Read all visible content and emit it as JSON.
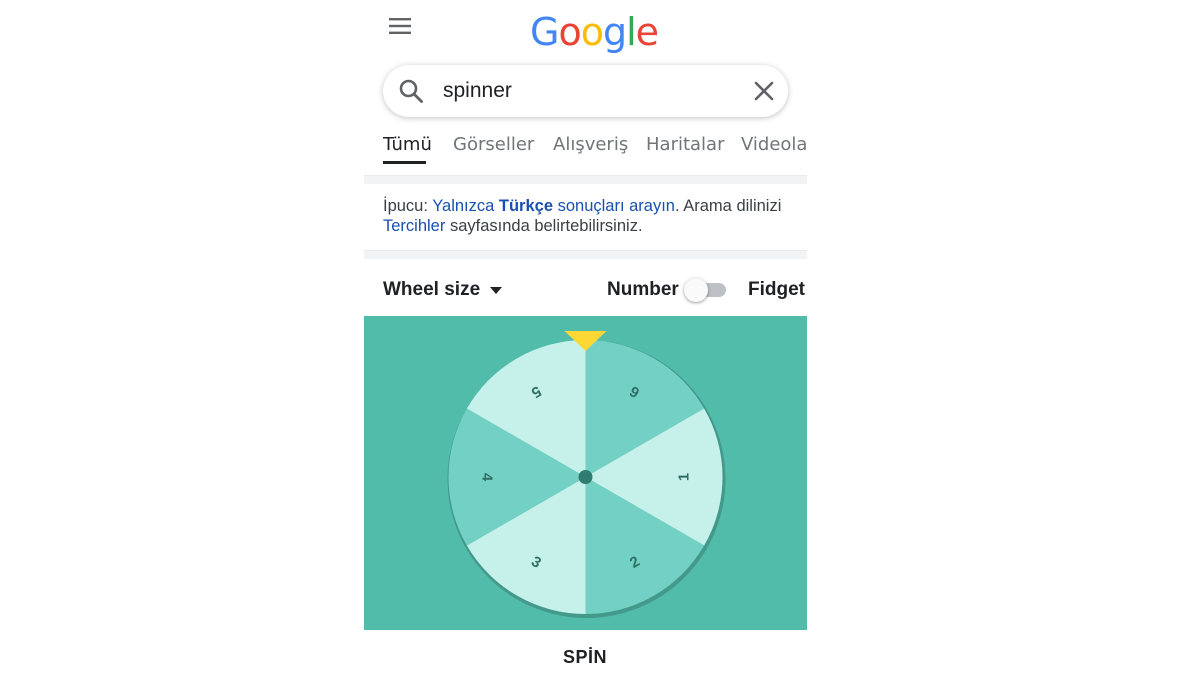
{
  "header": {
    "logo_text": "Google",
    "logo_colors": [
      "#4285F4",
      "#EA4335",
      "#FBBC05",
      "#4285F4",
      "#34A853",
      "#EA4335"
    ],
    "menu_icon": "hamburger-menu-icon"
  },
  "search": {
    "query": "spinner",
    "search_icon": "search-icon",
    "clear_icon": "close-icon"
  },
  "tabs": [
    {
      "label": "Tümü",
      "active": true
    },
    {
      "label": "Görseller",
      "active": false
    },
    {
      "label": "Alışveriş",
      "active": false
    },
    {
      "label": "Haritalar",
      "active": false
    },
    {
      "label": "Videolar",
      "active": false
    }
  ],
  "tip": {
    "prefix": "İpucu: ",
    "link1": "Yalnızca",
    "link_bold": "Türkçe",
    "link2": "sonuçları arayın",
    "middle": ". Arama dilinizi ",
    "link3": "Tercihler",
    "suffix": " sayfasında belirtebilirsiniz."
  },
  "controls": {
    "wheel_size_label": "Wheel size",
    "number_label": "Number",
    "fidget_label": "Fidget",
    "toggle_on": false
  },
  "wheel": {
    "numbers": [
      "1",
      "2",
      "3",
      "4",
      "5",
      "6"
    ],
    "background_color": "#52bcaa",
    "segment_colors": [
      "#c6f1ea",
      "#72d1c4"
    ],
    "pointer_color": "#fdd835",
    "hub_color": "#2e7d70"
  },
  "spin_button": {
    "label": "SPİN"
  }
}
